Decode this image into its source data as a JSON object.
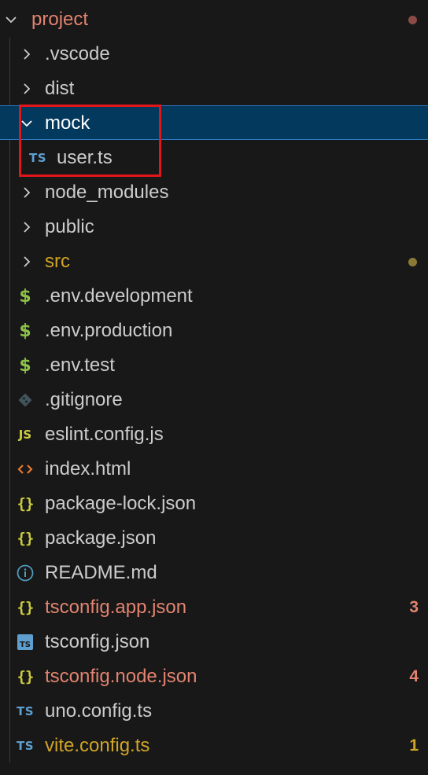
{
  "colors": {
    "background": "#181818",
    "selected_background": "#04395e",
    "selected_border": "#2b79c2",
    "modified_text": "#e2836f",
    "untracked_text": "#d0a424",
    "highlight_box": "#e3151a",
    "ts_icon": "#5e9fd0",
    "json_icon": "#cbcb41",
    "env_icon": "#8dc149",
    "html_icon": "#e37933"
  },
  "root": {
    "label": "project",
    "icon": "chevron-down-icon",
    "status": "modified-dot"
  },
  "items": [
    {
      "label": ".vscode",
      "icon": "chevron-right-icon"
    },
    {
      "label": "dist",
      "icon": "chevron-right-icon"
    },
    {
      "label": "mock",
      "icon": "chevron-down-icon"
    },
    {
      "label": "user.ts",
      "icon": "ts-file-icon"
    },
    {
      "label": "node_modules",
      "icon": "chevron-right-icon"
    },
    {
      "label": "public",
      "icon": "chevron-right-icon"
    },
    {
      "label": "src",
      "icon": "chevron-right-icon",
      "status": "untracked-dot"
    },
    {
      "label": ".env.development",
      "icon": "dollar-env-icon"
    },
    {
      "label": ".env.production",
      "icon": "dollar-env-icon"
    },
    {
      "label": ".env.test",
      "icon": "dollar-env-icon"
    },
    {
      "label": ".gitignore",
      "icon": "git-icon"
    },
    {
      "label": "eslint.config.js",
      "icon": "js-file-icon"
    },
    {
      "label": "index.html",
      "icon": "html-code-icon"
    },
    {
      "label": "package-lock.json",
      "icon": "json-braces-icon"
    },
    {
      "label": "package.json",
      "icon": "json-braces-icon"
    },
    {
      "label": "README.md",
      "icon": "info-icon"
    },
    {
      "label": "tsconfig.app.json",
      "icon": "json-braces-icon",
      "badge": "3"
    },
    {
      "label": "tsconfig.json",
      "icon": "ts-square-icon"
    },
    {
      "label": "tsconfig.node.json",
      "icon": "json-braces-icon",
      "badge": "4"
    },
    {
      "label": "uno.config.ts",
      "icon": "ts-file-icon"
    },
    {
      "label": "vite.config.ts",
      "icon": "ts-file-icon",
      "badge": "1"
    }
  ]
}
